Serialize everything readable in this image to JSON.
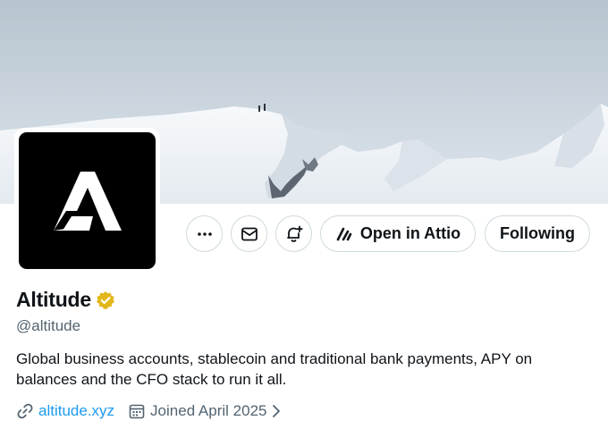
{
  "profile": {
    "name": "Altitude",
    "handle": "@altitude",
    "bio": "Global business accounts, stablecoin and traditional bank payments, APY on balances and the CFO stack to run it all.",
    "website": "altitude.xyz",
    "joined": "Joined April 2025",
    "avatar_glyph": "Λ"
  },
  "actions": {
    "more_icon": "more-icon",
    "message_icon": "mail-icon",
    "notify_icon": "bell-plus-icon",
    "open_label": "Open in Attio",
    "follow_label": "Following"
  },
  "colors": {
    "link": "#1d9bf0",
    "verified_badge": "#e2b719",
    "border": "#cfd9de",
    "muted": "#536471"
  }
}
